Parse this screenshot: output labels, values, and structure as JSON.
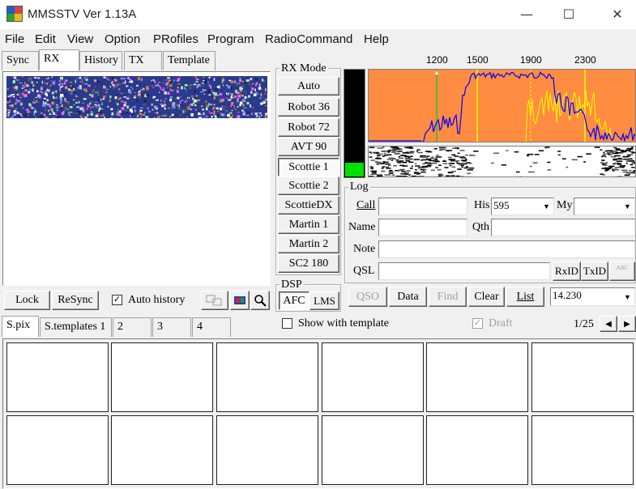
{
  "window": {
    "title": "MMSSTV Ver 1.13A",
    "controls": [
      "—",
      "☐",
      "✕"
    ]
  },
  "menubar": [
    "File",
    "Edit",
    "View",
    "Option",
    "PRofiles",
    "Program",
    "RadioCommand",
    "Help"
  ],
  "tabs": [
    "Sync",
    "RX",
    "History",
    "TX",
    "Template"
  ],
  "selected_tab": "RX",
  "rx_mode": {
    "group_label": "RX Mode",
    "buttons": [
      "Auto",
      "Robot 36",
      "Robot 72",
      "AVT 90",
      "Scottie 1",
      "Scottie 2",
      "ScottieDX",
      "Martin 1",
      "Martin 2",
      "SC2 180"
    ],
    "active": "Scottie 1"
  },
  "rx_bottom": {
    "lock": "Lock",
    "resync": "ReSync",
    "auto_history_label": "Auto history",
    "auto_history_checked": true
  },
  "dsp": {
    "label": "DSP",
    "afc": "AFC",
    "lms": "LMS"
  },
  "spectrum": {
    "tick_labels": [
      "1200",
      "1500",
      "1900",
      "2300"
    ],
    "background": "#ff8c40",
    "trace_color": "#0000ff",
    "peak_color": "#ffff00"
  },
  "level_meter": {
    "level_fraction": 0.13,
    "color": "#00e000"
  },
  "log": {
    "label": "Log",
    "call_label": "Call",
    "his_label": "His",
    "his_value": "595",
    "my_label": "My",
    "my_value": "",
    "name_label": "Name",
    "qth_label": "Qth",
    "note_label": "Note",
    "qsl_label": "QSL",
    "rxid": "RxID",
    "txid": "TxID",
    "abc_icon": "ABC"
  },
  "log_buttons": {
    "qso": "QSO",
    "data": "Data",
    "find": "Find",
    "clear": "Clear",
    "list": "List",
    "frequency": "14.230"
  },
  "stock_tabs": [
    "S.pix",
    "S.templates 1",
    "2",
    "3",
    "4"
  ],
  "show_with_template": "Show with template",
  "draft": "Draft",
  "page_indicator": "1/25"
}
